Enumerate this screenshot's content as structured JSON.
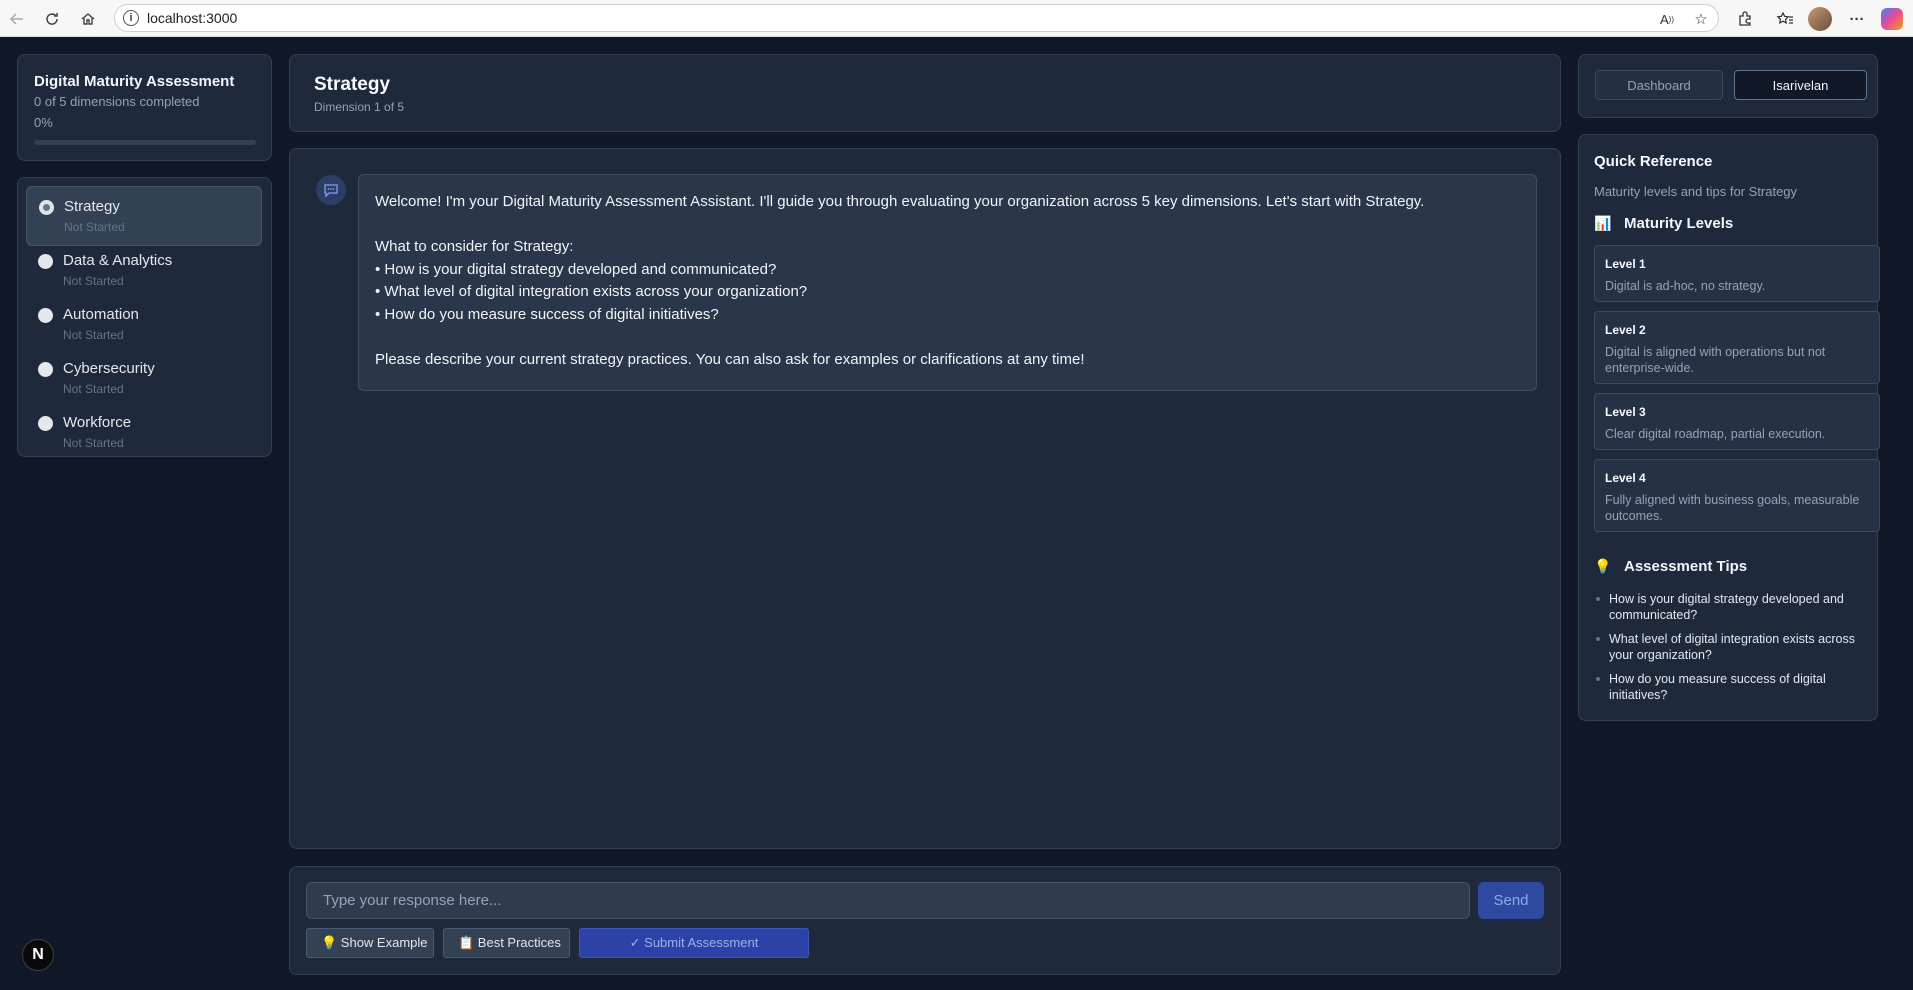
{
  "browser": {
    "url": "localhost:3000",
    "icons": [
      "back-arrow-icon",
      "refresh-icon",
      "home-icon",
      "site-info-icon",
      "read-aloud-icon",
      "favorite-star-icon",
      "extensions-icon",
      "favorites-icon",
      "profile-avatar-icon",
      "more-icon",
      "copilot-icon"
    ]
  },
  "progress": {
    "title": "Digital Maturity Assessment",
    "subtitle": "0 of 5 dimensions completed",
    "percent_label": "0%",
    "percent_value": 0
  },
  "dimensions": [
    {
      "label": "Strategy",
      "status": "Not Started",
      "active": true
    },
    {
      "label": "Data & Analytics",
      "status": "Not Started",
      "active": false
    },
    {
      "label": "Automation",
      "status": "Not Started",
      "active": false
    },
    {
      "label": "Cybersecurity",
      "status": "Not Started",
      "active": false
    },
    {
      "label": "Workforce",
      "status": "Not Started",
      "active": false
    }
  ],
  "header": {
    "title": "Strategy",
    "subtitle": "Dimension 1 of 5"
  },
  "chat": {
    "bot_icon": "chat-bubble-icon",
    "message_lines": [
      "Welcome! I'm your Digital Maturity Assessment Assistant. I'll guide you through evaluating your organization across 5 key dimensions. Let's start with Strategy.",
      "",
      "What to consider for Strategy:",
      "• How is your digital strategy developed and communicated?",
      "• What level of digital integration exists across your organization?",
      "• How do you measure success of digital initiatives?",
      "",
      "Please describe your current strategy practices. You can also ask for examples or clarifications at any time!"
    ]
  },
  "input": {
    "placeholder": "Type your response here...",
    "value": "",
    "send_label": "Send",
    "show_example_label": "💡 Show Example",
    "best_practices_label": "📋 Best Practices",
    "submit_label": "✓ Submit Assessment"
  },
  "top_nav": {
    "dashboard_label": "Dashboard",
    "user_label": "Isarivelan"
  },
  "reference": {
    "title": "Quick Reference",
    "subtitle": "Maturity levels and tips for Strategy",
    "levels_heading": "Maturity Levels",
    "levels_icon": "📊",
    "levels": [
      {
        "name": "Level 1",
        "desc": "Digital is ad-hoc, no strategy."
      },
      {
        "name": "Level 2",
        "desc": "Digital is aligned with operations but not enterprise-wide."
      },
      {
        "name": "Level 3",
        "desc": "Clear digital roadmap, partial execution."
      },
      {
        "name": "Level 4",
        "desc": "Fully aligned with business goals, measurable outcomes."
      }
    ],
    "tips_heading": "Assessment Tips",
    "tips_icon": "💡",
    "tips": [
      "How is your digital strategy developed and communicated?",
      "What level of digital integration exists across your organization?",
      "How do you measure success of digital initiatives?"
    ]
  },
  "framework_badge": "N",
  "colors": {
    "background": "#111827",
    "panel": "#1e293b",
    "accent": "#2d4aa0",
    "border": "#334155"
  }
}
